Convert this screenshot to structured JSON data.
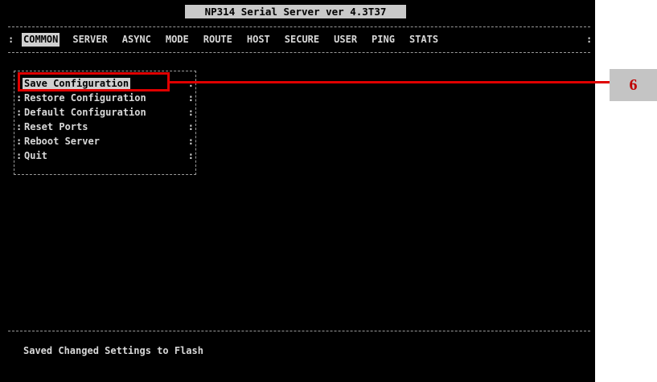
{
  "window": {
    "title": "NP314 Serial Server ver 4.3T37"
  },
  "menubar": {
    "items": [
      {
        "label": "COMMON",
        "active": true
      },
      {
        "label": "SERVER"
      },
      {
        "label": "ASYNC"
      },
      {
        "label": "MODE"
      },
      {
        "label": "ROUTE"
      },
      {
        "label": "HOST"
      },
      {
        "label": "SECURE"
      },
      {
        "label": "USER"
      },
      {
        "label": "PING"
      },
      {
        "label": "STATS"
      }
    ]
  },
  "submenu": {
    "items": [
      {
        "label": "Save Configuration",
        "selected": true
      },
      {
        "label": "Restore Configuration"
      },
      {
        "label": "Default Configuration"
      },
      {
        "label": "Reset Ports"
      },
      {
        "label": "Reboot Server"
      },
      {
        "label": "Quit"
      }
    ]
  },
  "status": {
    "message": "Saved Changed Settings to Flash"
  },
  "annotation": {
    "callout_number": "6",
    "color": "#e00000"
  },
  "colors": {
    "terminal_bg": "#000000",
    "terminal_fg": "#d8d8d8",
    "highlight_bg": "#d0d0d0"
  }
}
